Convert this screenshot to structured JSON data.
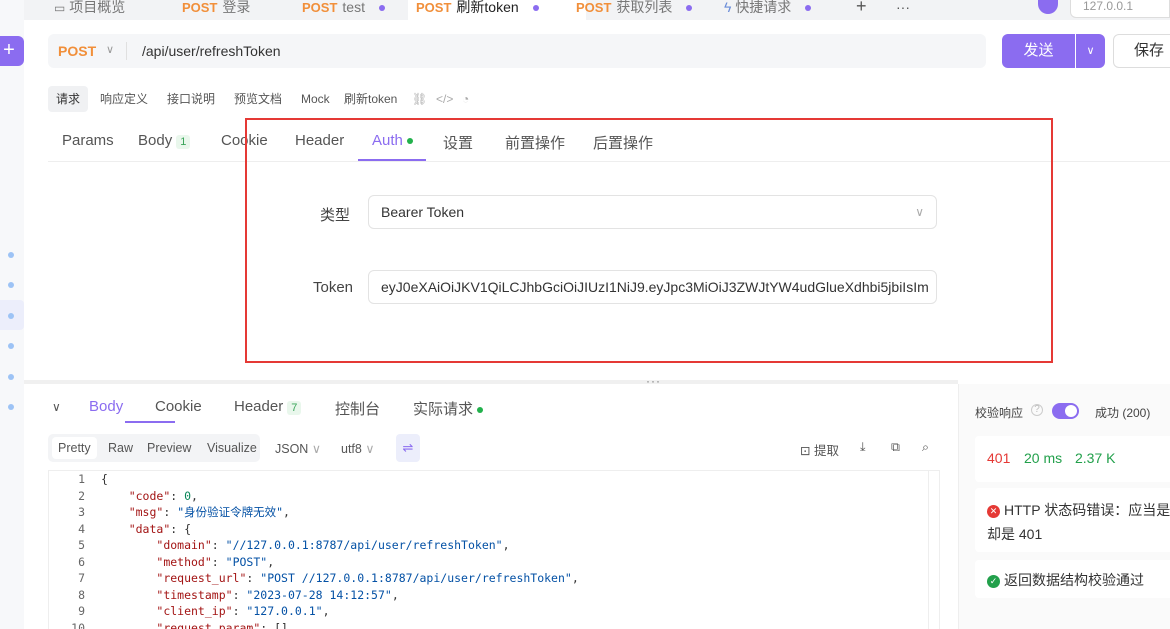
{
  "tabs": [
    {
      "method": "",
      "label": "项目概览"
    },
    {
      "method": "POST",
      "label": "登录"
    },
    {
      "method": "POST",
      "label": "test"
    },
    {
      "method": "POST",
      "label": "刷新token"
    },
    {
      "method": "POST",
      "label": "获取列表"
    },
    {
      "method": "",
      "label": "快捷请求"
    }
  ],
  "tab_add": "+",
  "tab_more": "···",
  "env_ip": "127.0.0.1",
  "request": {
    "method": "POST",
    "url": "/api/user/refreshToken",
    "send_label": "发送",
    "save_label": "保存"
  },
  "subtabs": [
    "请求",
    "响应定义",
    "接口说明",
    "预览文档",
    "Mock",
    "刷新token"
  ],
  "req_tabs": {
    "params": "Params",
    "body": "Body",
    "body_count": "1",
    "cookie": "Cookie",
    "header": "Header",
    "auth": "Auth",
    "settings": "设置",
    "pre": "前置操作",
    "post": "后置操作"
  },
  "auth": {
    "type_label": "类型",
    "type_value": "Bearer Token",
    "token_label": "Token",
    "token_value": "eyJ0eXAiOiJKV1QiLCJhbGciOiJIUzI1NiJ9.eyJpc3MiOiJ3ZWJtYW4udGlueXdhbi5jbiIsIm"
  },
  "response": {
    "tabs": {
      "body": "Body",
      "cookie": "Cookie",
      "header": "Header",
      "header_count": "7",
      "console": "控制台",
      "actual": "实际请求"
    },
    "formats": [
      "Pretty",
      "Raw",
      "Preview",
      "Visualize"
    ],
    "lang": "JSON",
    "encoding": "utf8",
    "extract": "提取",
    "line_numbers": [
      "1",
      "2",
      "3",
      "4",
      "5",
      "6",
      "7",
      "8",
      "9",
      "10"
    ],
    "code_lines": [
      "{",
      "    \"code\": 0,",
      "    \"msg\": \"身份验证令牌无效\",",
      "    \"data\": {",
      "        \"domain\": \"//127.0.0.1:8787/api/user/refreshToken\",",
      "        \"method\": \"POST\",",
      "        \"request_url\": \"POST //127.0.0.1:8787/api/user/refreshToken\",",
      "        \"timestamp\": \"2023-07-28 14:12:57\",",
      "        \"client_ip\": \"127.0.0.1\",",
      "        \"request_param\": []"
    ]
  },
  "validation": {
    "label": "校验响应",
    "success": "成功 (200)",
    "status": "401",
    "time": "20 ms",
    "size": "2.37 K",
    "error_line1": "HTTP 状态码错误：应当是",
    "error_line2": "却是 401",
    "ok_text": "返回数据结构校验通过"
  }
}
